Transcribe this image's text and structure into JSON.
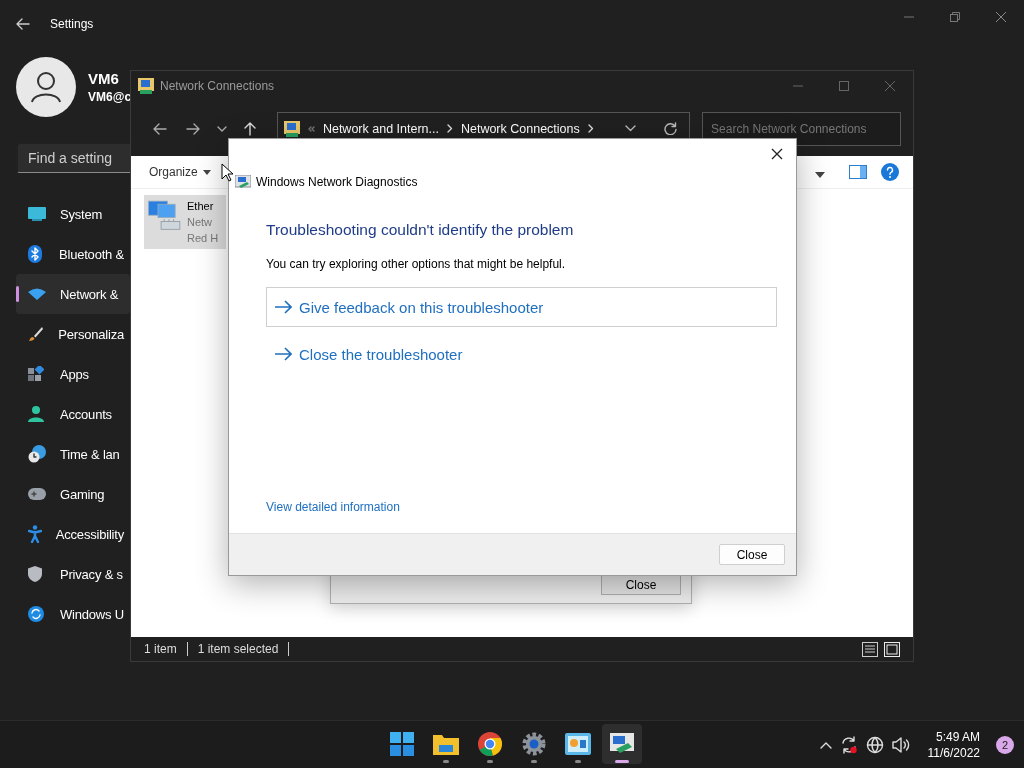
{
  "settings": {
    "title": "Settings",
    "user": {
      "name": "VM6",
      "email": "VM6@c"
    },
    "search": {
      "placeholder": "Find a setting"
    },
    "nav": [
      {
        "label": "System",
        "selected": false
      },
      {
        "label": "Bluetooth &",
        "selected": false
      },
      {
        "label": "Network &",
        "selected": true
      },
      {
        "label": "Personaliza",
        "selected": false
      },
      {
        "label": "Apps",
        "selected": false
      },
      {
        "label": "Accounts",
        "selected": false
      },
      {
        "label": "Time & lan",
        "selected": false
      },
      {
        "label": "Gaming",
        "selected": false
      },
      {
        "label": "Accessibility",
        "selected": false
      },
      {
        "label": "Privacy & s",
        "selected": false
      },
      {
        "label": "Windows U",
        "selected": false
      }
    ]
  },
  "network_connections": {
    "title": "Network Connections",
    "address": [
      "Network and Intern...",
      "Network Connections"
    ],
    "search": {
      "placeholder": "Search Network Connections"
    },
    "organize": "Organize",
    "items": [
      {
        "name": "Ether",
        "line_2": "Netw",
        "line_3": "Red H",
        "selected": true
      }
    ],
    "status": [
      "1 item",
      "1 item selected"
    ]
  },
  "background_dialog": {
    "button": "Close"
  },
  "dialog": {
    "title": "Windows Network Diagnostics",
    "heading": "Troubleshooting couldn't identify the problem",
    "message": "You can try exploring other options that might be helpful.",
    "options": [
      {
        "label": "Give feedback on this troubleshooter",
        "focused": true
      },
      {
        "label": "Close the troubleshooter",
        "focused": false
      }
    ],
    "details_link": "View detailed information",
    "button": "Close"
  },
  "taskbar": {
    "apps": [
      {
        "running": false,
        "selected": false
      },
      {
        "running": true,
        "selected": false
      },
      {
        "running": true,
        "selected": false
      },
      {
        "running": true,
        "selected": false
      },
      {
        "running": true,
        "selected": false
      },
      {
        "running": true,
        "selected": true
      }
    ],
    "clock": {
      "time": "5:49 AM",
      "date": "11/6/2022"
    },
    "notifications": "2"
  }
}
